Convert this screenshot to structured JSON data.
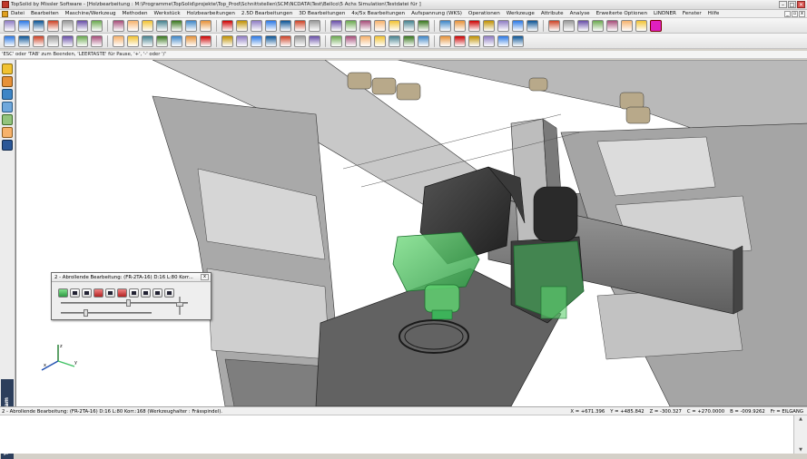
{
  "window": {
    "title": "TopSolid by Missler Software - [Holzbearbeitung : M:\\Programme\\TopSolid\\projekte\\Top_Prod\\Schnittstellen\\SCM\\NCDATA\\Test\\Bellco\\5 Achs Simulation\\Testdatei für ]",
    "minimize": "–",
    "maximize": "□",
    "close": "✕"
  },
  "menu": {
    "items": [
      "Datei",
      "Bearbeiten",
      "Maschine/Werkzeug",
      "Methoden",
      "Werkstück",
      "Holzbearbeitungen",
      "2.5D Bearbeitungen",
      "3D Bearbeitungen",
      "4x/5x Bearbeitungen",
      "Aufspannung (WKS)",
      "Operationen",
      "Werkzeuge",
      "Attribute",
      "Analyse",
      "Erweiterte Optionen",
      "LINDNER",
      "Fenster",
      "Hilfe"
    ],
    "child_minimize": "_",
    "child_restore": "▫",
    "child_close": "x"
  },
  "hint": "'ESC' oder 'TAB' zum Beenden, 'LEERTASTE' für Pause, '+', '-' oder '/'",
  "brand": "TopSolid'WoodCam",
  "dialog": {
    "title": "2 - Abrollende Bearbeitung:   (FR-2TA-16)  D:16  L:80  Korr...",
    "close": "x"
  },
  "status": {
    "left": "2 - Abrollende Bearbeitung:     (FR-2TA-16)  D:16  L:80  Korr.:168  (Werkzeughalter : Frässpindel).",
    "x": "X = +671.396",
    "y": "Y = +485.842",
    "z": "Z = -300.327",
    "c": "C = +270.0000",
    "b": "B = -009.9262",
    "fr": "Fr = EILGANG"
  },
  "colors": {
    "accent_green": "#3cc060",
    "magenta": "#e020c0",
    "brand_bg": "#2d3f5c"
  }
}
